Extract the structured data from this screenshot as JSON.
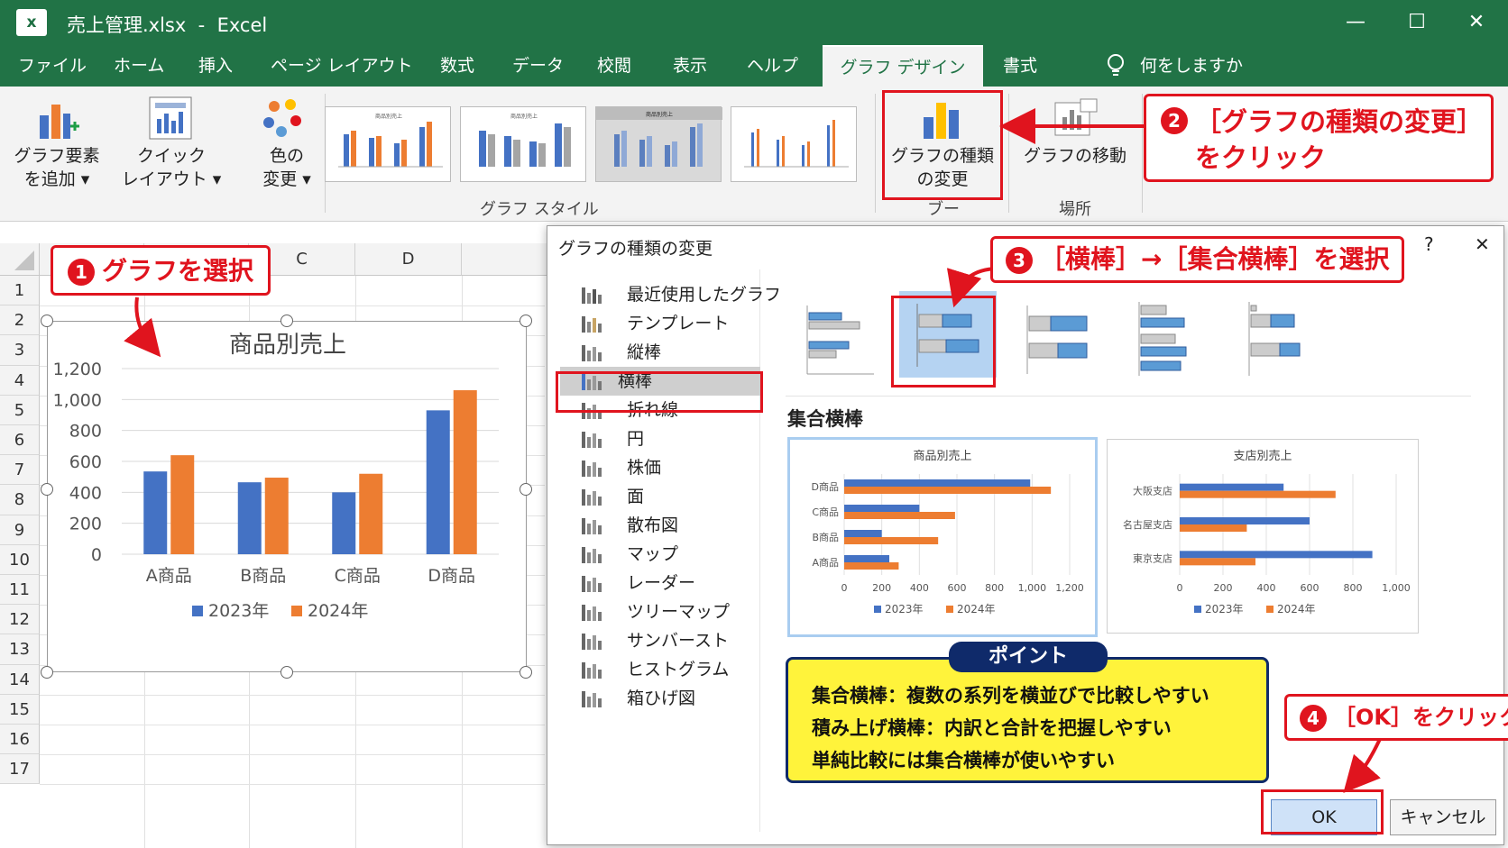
{
  "window": {
    "title": "売上管理.xlsx  -  Excel",
    "logo": "x",
    "controls": [
      "—",
      "☐",
      "✕"
    ]
  },
  "tabs": [
    {
      "label": "ファイル"
    },
    {
      "label": "ホーム"
    },
    {
      "label": "挿入"
    },
    {
      "label": "ページ レイアウト"
    },
    {
      "label": "数式"
    },
    {
      "label": "データ"
    },
    {
      "label": "校閲"
    },
    {
      "label": "表示"
    },
    {
      "label": "ヘルプ"
    },
    {
      "label": "グラフ デザイン",
      "active": true
    },
    {
      "label": "書式"
    }
  ],
  "tell_me": "何をしますか",
  "ribbon": {
    "add_element": "グラフ要素\nを追加 ▾",
    "quick_layout": "クイック\nレイアウト ▾",
    "change_color": "色の\n変更 ▾",
    "chart_styles_group": "グラフ スタイル",
    "change_type": "グラフの種類\nの変更",
    "type_group": "ブー",
    "move_chart": "グラフの移動",
    "location_group": "場所",
    "style_thumb_title": "商品別売上"
  },
  "sheet": {
    "columns": [
      "C",
      "D"
    ],
    "rows": [
      "1",
      "2",
      "3",
      "4",
      "5",
      "6",
      "7",
      "8",
      "9",
      "10",
      "11",
      "12",
      "13",
      "14",
      "15",
      "16",
      "17"
    ]
  },
  "chart_data": [
    {
      "type": "bar",
      "title": "商品別売上",
      "categories": [
        "A商品",
        "B商品",
        "C商品",
        "D商品"
      ],
      "series": [
        {
          "name": "2023年",
          "values": [
            535,
            465,
            400,
            930
          ],
          "color": "#4472c4"
        },
        {
          "name": "2024年",
          "values": [
            640,
            495,
            520,
            1060
          ],
          "color": "#ed7d31"
        }
      ],
      "ylim": [
        0,
        1200
      ],
      "yticks": [
        "0",
        "200",
        "400",
        "600",
        "800",
        "1,000",
        "1,200"
      ],
      "legend": "bottom",
      "grid": true
    },
    {
      "type": "barh",
      "title": "商品別売上",
      "categories": [
        "A商品",
        "B商品",
        "C商品",
        "D商品"
      ],
      "series": [
        {
          "name": "2023年",
          "values": [
            240,
            200,
            400,
            990
          ],
          "color": "#4472c4"
        },
        {
          "name": "2024年",
          "values": [
            290,
            500,
            590,
            1100
          ],
          "color": "#ed7d31"
        }
      ],
      "xlim": [
        0,
        1200
      ],
      "xticks": [
        "0",
        "200",
        "400",
        "600",
        "800",
        "1,000",
        "1,200"
      ],
      "legend": "bottom"
    },
    {
      "type": "barh",
      "title": "支店別売上",
      "categories": [
        "東京支店",
        "名古屋支店",
        "大阪支店"
      ],
      "series": [
        {
          "name": "2023年",
          "values": [
            890,
            600,
            480
          ],
          "color": "#4472c4"
        },
        {
          "name": "2024年",
          "values": [
            350,
            310,
            720
          ],
          "color": "#ed7d31"
        }
      ],
      "xlim": [
        0,
        1000
      ],
      "xticks": [
        "0",
        "200",
        "400",
        "600",
        "800",
        "1,000"
      ],
      "legend": "bottom"
    }
  ],
  "dialog": {
    "title": "グラフの種類の変更",
    "help": "?",
    "close": "✕",
    "categories": [
      {
        "label": "最近使用したグラフ",
        "icon": "undo-icon"
      },
      {
        "label": "テンプレート",
        "icon": "folder-icon"
      },
      {
        "label": "縦棒",
        "icon": "column-chart-icon"
      },
      {
        "label": "横棒",
        "icon": "bar-chart-icon",
        "selected": true
      },
      {
        "label": "折れ線",
        "icon": "line-chart-icon"
      },
      {
        "label": "円",
        "icon": "pie-chart-icon"
      },
      {
        "label": "株価",
        "icon": "stock-chart-icon"
      },
      {
        "label": "面",
        "icon": "area-chart-icon"
      },
      {
        "label": "散布図",
        "icon": "scatter-chart-icon"
      },
      {
        "label": "マップ",
        "icon": "map-icon"
      },
      {
        "label": "レーダー",
        "icon": "radar-chart-icon"
      },
      {
        "label": "ツリーマップ",
        "icon": "treemap-icon"
      },
      {
        "label": "サンバースト",
        "icon": "sunburst-icon"
      },
      {
        "label": "ヒストグラム",
        "icon": "histogram-icon"
      },
      {
        "label": "箱ひげ図",
        "icon": "boxplot-icon"
      }
    ],
    "subtype_title": "集合横棒",
    "ok": "OK",
    "cancel": "キャンセル"
  },
  "point": {
    "title": "ポイント",
    "lines": [
      "集合横棒：複数の系列を横並びで比較しやすい",
      "積み上げ横棒：内訳と合計を把握しやすい",
      "単純比較には集合横棒が使いやすい"
    ]
  },
  "annotations": {
    "step1_num": "1",
    "step1": "グラフを選択",
    "step2_num": "2",
    "step2": "［グラフの種類の変更］\nをクリック",
    "step3_num": "3",
    "step3": "［横棒］→［集合横棒］を選択",
    "step4_num": "4",
    "step4": "［OK］をクリック"
  },
  "colors": {
    "excel_green": "#217346",
    "series1": "#4472c4",
    "series2": "#ed7d31",
    "callout_red": "#e0141e"
  }
}
